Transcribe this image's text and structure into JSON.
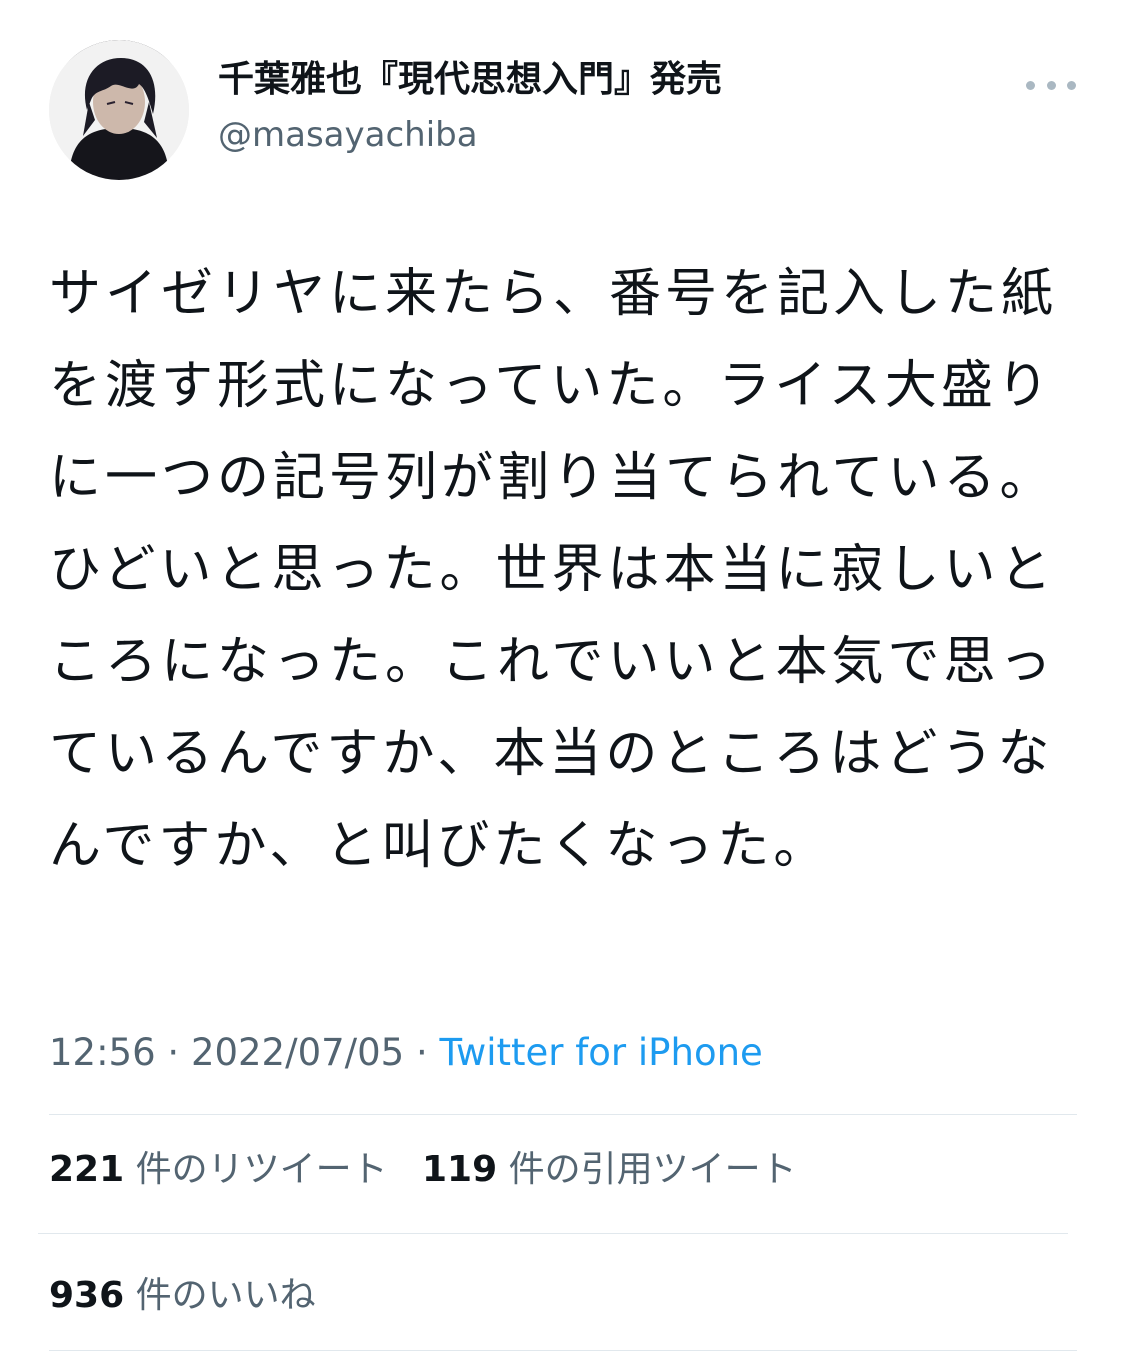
{
  "author": {
    "display_name": "千葉雅也『現代思想入門』発売",
    "handle": "@masayachiba",
    "avatar_icon": "user-avatar"
  },
  "tweet": {
    "text": "サイゼリヤに来たら、番号を記入した紙を渡す形式になっていた。ライス大盛りに一つの記号列が割り当てられている。ひどいと思った。世界は本当に寂しいところになった。これでいいと本気で思っているんですか、本当のところはどうなんですか、と叫びたくなった。"
  },
  "meta": {
    "time": "12:56",
    "separator": "·",
    "date": "2022/07/05",
    "source": "Twitter for iPhone"
  },
  "stats": {
    "retweets_count": "221",
    "retweets_label": "件のリツイート",
    "quotes_count": "119",
    "quotes_label": "件の引用ツイート",
    "likes_count": "936",
    "likes_label": "件のいいね"
  },
  "colors": {
    "text": "#0f1419",
    "secondary": "#536471",
    "link": "#1d9bf0",
    "divider": "#e1e8ed"
  }
}
